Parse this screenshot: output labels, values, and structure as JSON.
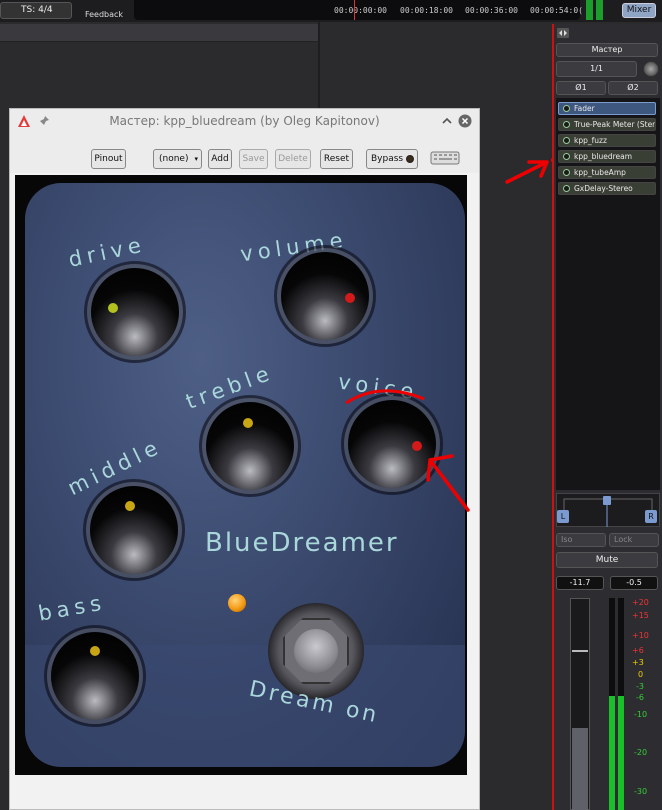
{
  "topbar": {
    "ts_label": "TS: 4/4",
    "feedback_label": "Feedback",
    "timecodes": [
      "00:00:00:00",
      "00:00:18:00",
      "00:00:36:00",
      "00:00:54:0("
    ],
    "mixer_button": "Mixer"
  },
  "plugin_window": {
    "title": "Мастер: kpp_bluedream (by Oleg Kapitonov)",
    "toolbar": {
      "pinout": "Pinout",
      "preset": "(none)",
      "add": "Add",
      "save": "Save",
      "delete": "Delete",
      "reset": "Reset",
      "bypass": "Bypass"
    },
    "pedal": {
      "brand": "BlueDreamer",
      "footswitch_label": "Dream on",
      "knobs": [
        {
          "id": "drive",
          "label": "drive",
          "dot_color": "#b4c21e"
        },
        {
          "id": "volume",
          "label": "volume",
          "dot_color": "#d21a1a"
        },
        {
          "id": "treble",
          "label": "treble",
          "dot_color": "#c8a515"
        },
        {
          "id": "voice",
          "label": "voice",
          "dot_color": "#d21a1a"
        },
        {
          "id": "middle",
          "label": "middle",
          "dot_color": "#c8a515"
        },
        {
          "id": "bass",
          "label": "bass",
          "dot_color": "#c8a515"
        }
      ],
      "led_color": "#f39a13"
    }
  },
  "mixer_strip": {
    "name": "Мастер",
    "input": "1/1",
    "phase_left": "Ø1",
    "phase_right": "Ø2",
    "plugins": [
      "Fader",
      "True-Peak Meter (Stereo)",
      "kpp_fuzz",
      "kpp_bluedream",
      "kpp_tubeAmp",
      "GxDelay-Stereo"
    ],
    "pan_left": "L",
    "pan_right": "R",
    "iso": "Iso",
    "lock": "Lock",
    "mute": "Mute",
    "gain_left": "-11.7",
    "gain_right": "-0.5",
    "meter_scale": [
      "+20",
      "+15",
      "+10",
      "+6",
      "+3",
      "0",
      "-3",
      "-6",
      "-10",
      "-20",
      "-30"
    ]
  }
}
